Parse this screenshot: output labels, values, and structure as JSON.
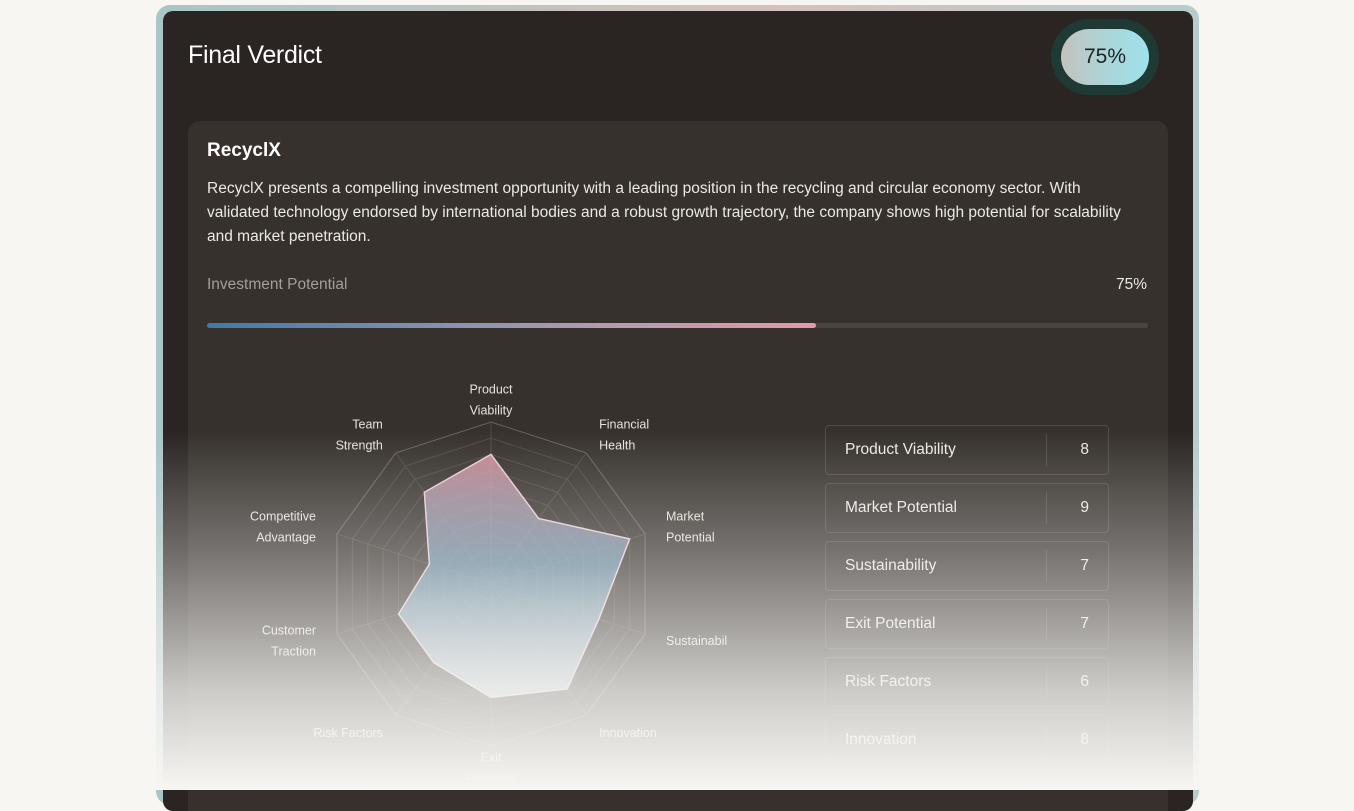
{
  "header": {
    "title": "Final Verdict",
    "score_badge": "75%"
  },
  "company": {
    "name": "RecyclX",
    "description": "RecyclX presents a compelling investment opportunity with a leading position in the recycling and circular economy sector. With validated technology endorsed by international bodies and a robust growth trajectory, the company shows high potential for scalability and market penetration."
  },
  "investment_potential": {
    "label": "Investment Potential",
    "value_text": "75%",
    "fraction": 0.647
  },
  "colors": {
    "panel_bg": "#2a2522",
    "card_bg": "#36312d",
    "accent_teal": "#9ee2ec",
    "accent_pink": "#e29aa8",
    "accent_blue": "#3f7aa6"
  },
  "chart_data": {
    "type": "radar",
    "rmax": 10,
    "rings": 10,
    "axes": [
      {
        "label": [
          "Product",
          "Viability"
        ],
        "value": 8
      },
      {
        "label": [
          "Financial",
          "Health"
        ],
        "value": 5
      },
      {
        "label": [
          "Market",
          "Potential"
        ],
        "value": 9
      },
      {
        "label": [
          "Sustainability"
        ],
        "value": 7
      },
      {
        "label": [
          "Innovation"
        ],
        "value": 8
      },
      {
        "label": [
          "Exit",
          "Potential"
        ],
        "value": 7
      },
      {
        "label": [
          "Risk Factors"
        ],
        "value": 6
      },
      {
        "label": [
          "Customer",
          "Traction"
        ],
        "value": 6
      },
      {
        "label": [
          "Competitive",
          "Advantage"
        ],
        "value": 4
      },
      {
        "label": [
          "Team",
          "Strength"
        ],
        "value": 7
      }
    ]
  },
  "scores": [
    {
      "name": "Product Viability",
      "value": "8"
    },
    {
      "name": "Market Potential",
      "value": "9"
    },
    {
      "name": "Sustainability",
      "value": "7"
    },
    {
      "name": "Exit Potential",
      "value": "7"
    },
    {
      "name": "Risk Factors",
      "value": "6"
    },
    {
      "name": "Innovation",
      "value": "8"
    }
  ]
}
